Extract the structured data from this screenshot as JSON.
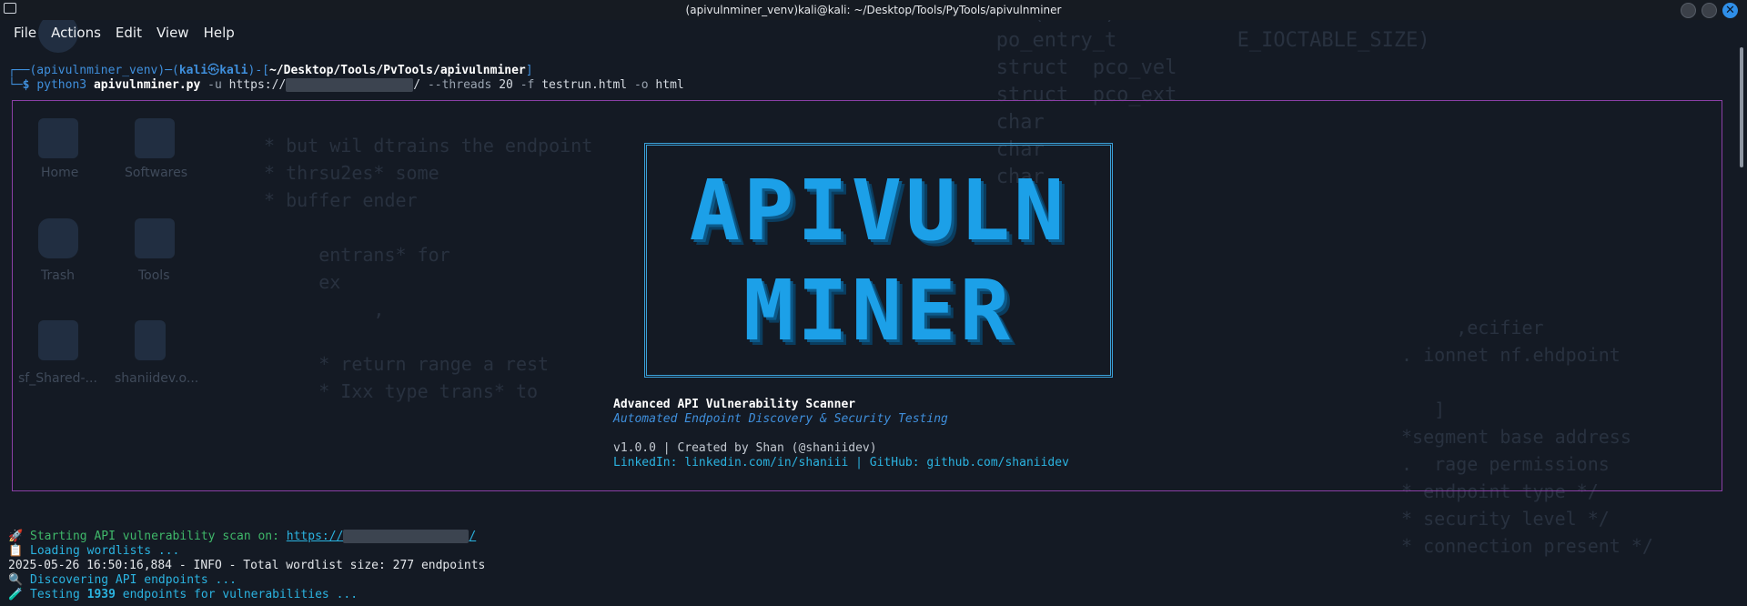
{
  "window": {
    "title": "(apivulnminer_venv)kali@kali: ~/Desktop/Tools/PyTools/apivulnminer"
  },
  "menu": [
    "File",
    "Actions",
    "Edit",
    "View",
    "Help"
  ],
  "desktop": {
    "icons": [
      "Home",
      "Softwares",
      "Trash",
      "Tools",
      "sf_Shared-...",
      "shaniidev.o..."
    ]
  },
  "prompt": {
    "venv": "(apivulnminer_venv)",
    "user": "kali",
    "at": "㉿",
    "host": "kali",
    "path": "~/Desktop/Tools/PvTools/apivulnminer"
  },
  "command": {
    "prefix": "python3",
    "script": "apivulnminer.py",
    "flag_u": "-u",
    "url_start": "https://",
    "url_end": "/",
    "threads_flag": "--threads",
    "threads_value": "20",
    "flag_f": "-f",
    "f_value": "testrun.html",
    "flag_o": "-o",
    "o_value": "html"
  },
  "banner": {
    "logo_line1": "APIVULN",
    "logo_line2": "MINER",
    "title": "Advanced API Vulnerability Scanner",
    "subtitle": "Automated Endpoint Discovery & Security Testing",
    "version_line": "v1.0.0 | Created by Shan (@shaniidev)",
    "links_line": "LinkedIn: linkedin.com/in/shaniii | GitHub: github.com/shaniidev"
  },
  "output": [
    {
      "icon": "🚀",
      "text": "Starting API vulnerability scan on: ",
      "link": "https://",
      "link_end": "/"
    },
    {
      "icon": "📋",
      "text": "Loading wordlists ..."
    },
    {
      "icon": "",
      "text": "2025-05-26 16:50:16,884 - INFO - Total wordlist size: 277 endpoints"
    },
    {
      "icon": "🔍",
      "text": "Discovering API endpoints ..."
    },
    {
      "icon": "🧪",
      "pre": "Testing ",
      "count": "1939",
      "post": " endpoints for vulnerabilities ..."
    }
  ],
  "colors": {
    "background": "#141a24",
    "accent_blue": "#1ca0e8",
    "panel_border": "#8b3fa6",
    "prompt_blue": "#3f8fdc"
  }
}
